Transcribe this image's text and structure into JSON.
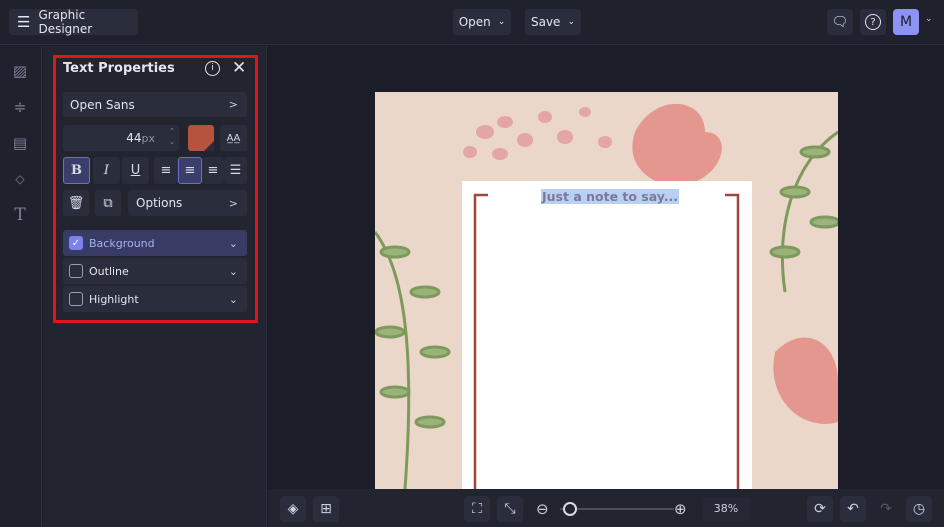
{
  "app": {
    "title": "Graphic Designer",
    "open_label": "Open",
    "save_label": "Save",
    "avatar": "M"
  },
  "panel": {
    "title": "Text Properties",
    "font": "Open Sans",
    "size_value": "44",
    "size_unit": "px",
    "color": "#b5533f",
    "options_label": "Options",
    "toggles": [
      {
        "label": "Background",
        "checked": true
      },
      {
        "label": "Outline",
        "checked": false
      },
      {
        "label": "Highlight",
        "checked": false
      }
    ]
  },
  "canvas": {
    "text": "Just a note to say..."
  },
  "bottom": {
    "zoom": "38%",
    "zoom_fraction": 0.05
  }
}
